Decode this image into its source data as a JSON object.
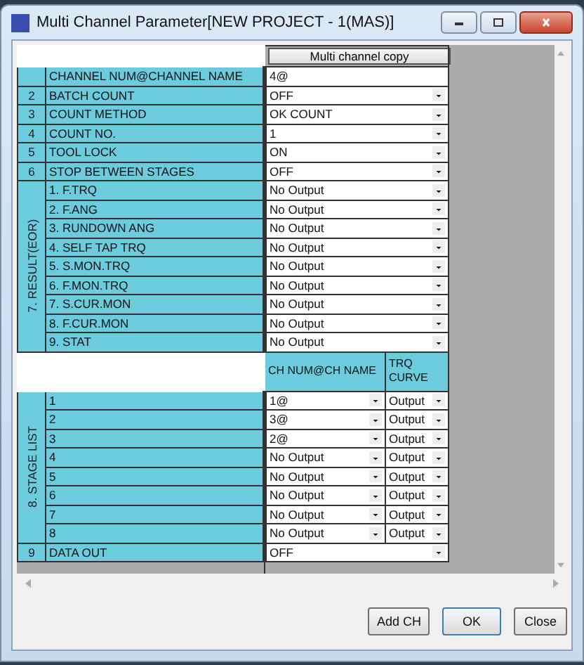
{
  "window": {
    "title": "Multi Channel Parameter[NEW PROJECT - 1(MAS)]"
  },
  "copy_button": "Multi channel copy",
  "params": [
    {
      "label": "CHANNEL NUM@CHANNEL NAME",
      "value": "4@",
      "kind": "text"
    },
    {
      "no": "2",
      "label": "BATCH COUNT",
      "value": "OFF",
      "kind": "dropdown"
    },
    {
      "no": "3",
      "label": "COUNT METHOD",
      "value": "OK COUNT",
      "kind": "dropdown"
    },
    {
      "no": "4",
      "label": "COUNT NO.",
      "value": "1",
      "kind": "dropdown"
    },
    {
      "no": "5",
      "label": "TOOL LOCK",
      "value": "ON",
      "kind": "dropdown"
    },
    {
      "no": "6",
      "label": "STOP BETWEEN STAGES",
      "value": "OFF",
      "kind": "dropdown"
    }
  ],
  "result_group": {
    "label": "7. RESULT(EOR)",
    "items": [
      {
        "label": "1. F.TRQ",
        "value": "No Output"
      },
      {
        "label": "2. F.ANG",
        "value": "No Output"
      },
      {
        "label": "3. RUNDOWN ANG",
        "value": "No Output"
      },
      {
        "label": "4. SELF TAP TRQ",
        "value": "No Output"
      },
      {
        "label": "5. S.MON.TRQ",
        "value": "No Output"
      },
      {
        "label": "6. F.MON.TRQ",
        "value": "No Output"
      },
      {
        "label": "7. S.CUR.MON",
        "value": "No Output"
      },
      {
        "label": "8. F.CUR.MON",
        "value": "No Output"
      },
      {
        "label": "9. STAT",
        "value": "No Output"
      }
    ]
  },
  "stage_group": {
    "label": "8. STAGE LIST",
    "columns": [
      "CH NUM@CH NAME",
      "TRQ CURVE"
    ],
    "rows": [
      {
        "label": "1",
        "ch": "1@",
        "curve": "Output"
      },
      {
        "label": "2",
        "ch": "3@",
        "curve": "Output"
      },
      {
        "label": "3",
        "ch": "2@",
        "curve": "Output"
      },
      {
        "label": "4",
        "ch": "No Output",
        "curve": "Output"
      },
      {
        "label": "5",
        "ch": "No Output",
        "curve": "Output"
      },
      {
        "label": "6",
        "ch": "No Output",
        "curve": "Output"
      },
      {
        "label": "7",
        "ch": "No Output",
        "curve": "Output"
      },
      {
        "label": "8",
        "ch": "No Output",
        "curve": "Output"
      }
    ]
  },
  "data_out": {
    "no": "9",
    "label": "DATA OUT",
    "value": "OFF"
  },
  "buttons": [
    {
      "label": "Add CH",
      "default": false
    },
    {
      "label": "OK",
      "default": true
    },
    {
      "label": "Close",
      "default": false
    }
  ]
}
